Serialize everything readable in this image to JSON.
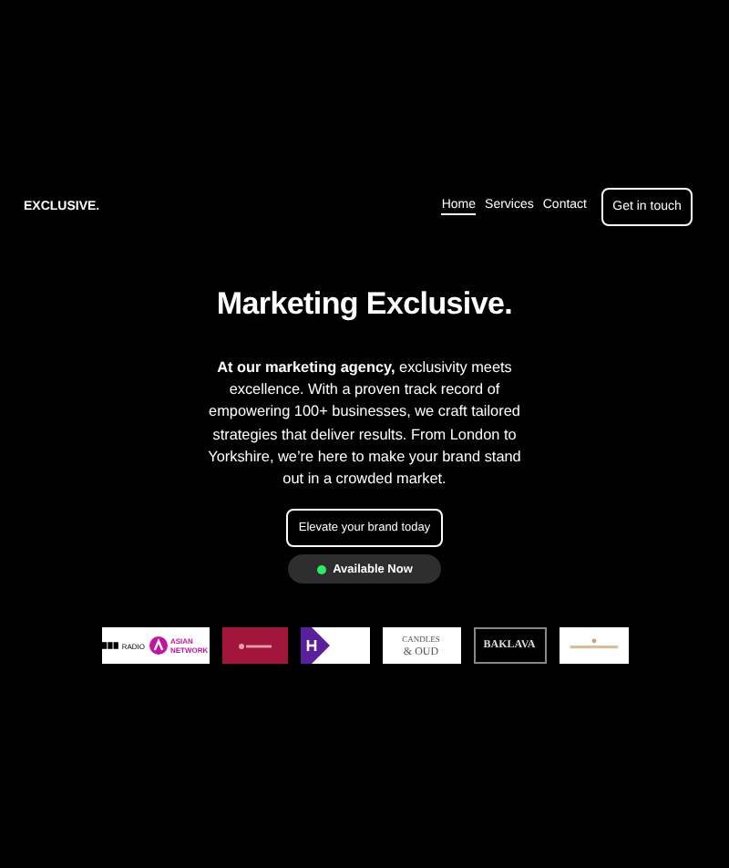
{
  "brand": "EXCLUSIVE.",
  "nav": [
    {
      "label": "Home",
      "selected": true
    },
    {
      "label": "Services",
      "selected": false
    },
    {
      "label": "Contact",
      "selected": false
    }
  ],
  "cta": "Get in touch",
  "hero": {
    "title": "Marketing Exclusive.",
    "text": "**At our marketing agency,** exclusivity meets excellence. With a proven track record of empowering 100+ businesses, we craft tailored strategies that deliver results. From London to Yorkshire, we’re here to make your brand stand out in a crowded market.",
    "button": "Elevate your brand today",
    "status": "Available Now"
  },
  "logos": [
    {
      "kind": "radio",
      "texts": [
        "RADIO",
        "ASIAN",
        "NETWORK"
      ]
    },
    {
      "kind": "crimson"
    },
    {
      "kind": "purple"
    },
    {
      "kind": "script",
      "texts": [
        "CANDLES",
        "& OUD"
      ]
    },
    {
      "kind": "dark",
      "texts": [
        "BAKLAVA"
      ]
    },
    {
      "kind": "gold"
    }
  ]
}
